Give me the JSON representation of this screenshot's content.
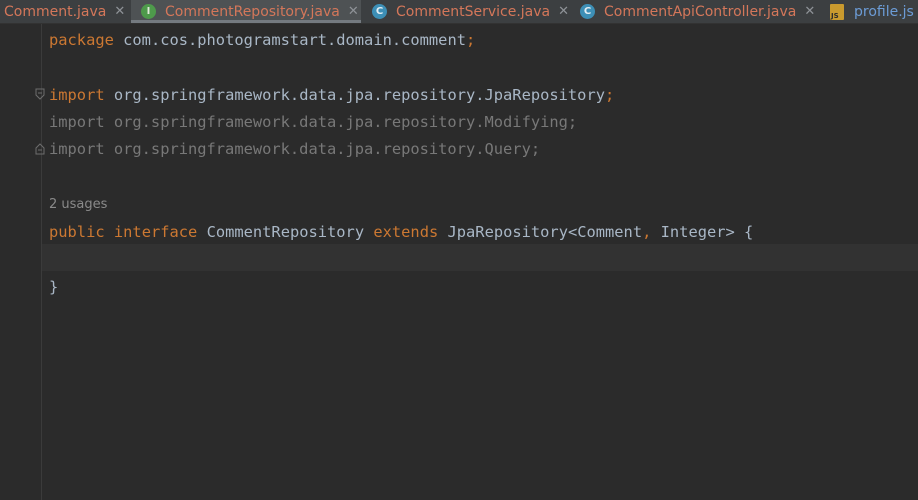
{
  "tabs": [
    {
      "label": "Comment.java",
      "icon": "none",
      "active": false
    },
    {
      "label": "CommentRepository.java",
      "icon": "interface-icon",
      "icon_letter": "I",
      "active": true
    },
    {
      "label": "CommentService.java",
      "icon": "class-icon",
      "icon_letter": "C",
      "active": false
    },
    {
      "label": "CommentApiController.java",
      "icon": "class-icon",
      "icon_letter": "C",
      "active": false
    },
    {
      "label": "profile.js",
      "icon": "js-file-icon",
      "icon_letter": "JS",
      "active": false
    }
  ],
  "close_glyph": "✕",
  "code": {
    "package_kw": "package",
    "package_name": " com.cos.photogramstart.domain.comment",
    "semicolon": ";",
    "import_kw": "import",
    "import1": " org.springframework.data.jpa.repository.JpaRepository",
    "import2": "import org.springframework.data.jpa.repository.Modifying;",
    "import3": "import org.springframework.data.jpa.repository.Query;",
    "usages": "2 usages",
    "public_kw": "public",
    "interface_kw": "interface",
    "class_name": " CommentRepository ",
    "extends_kw": "extends",
    "generic": " JpaRepository<Comment",
    "comma": ",",
    "generic2": " Integer> {",
    "closing_brace": "}"
  },
  "colors": {
    "background": "#2b2b2b",
    "keyword": "#cc7832",
    "text": "#a9b7c6",
    "unused_import": "#787878",
    "tab_label": "#d4775a",
    "js_tab_label": "#6c9cd6"
  }
}
